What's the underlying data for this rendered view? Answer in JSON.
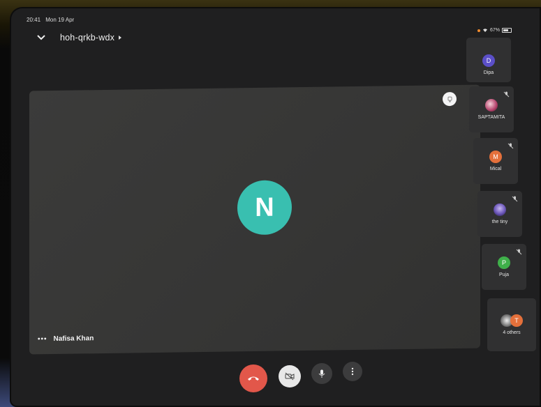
{
  "status": {
    "time": "20:41",
    "date": "Mon 19 Apr",
    "battery": "67%"
  },
  "meeting": {
    "code": "hoh-qrkb-wdx"
  },
  "main": {
    "initial": "N",
    "name": "Nafisa Khan",
    "avatar_color": "#39bfb0"
  },
  "participants": [
    {
      "name": "Dipa",
      "initial": "D",
      "color": "#5b4fc8",
      "muted": false
    },
    {
      "name": "SAPTAMITA",
      "initial": "",
      "color": "#b3406a",
      "muted": true
    },
    {
      "name": "Mical",
      "initial": "M",
      "color": "#e4703b",
      "muted": true
    },
    {
      "name": "the tiny",
      "initial": "",
      "color": "#6a55b8",
      "muted": true
    },
    {
      "name": "Puja",
      "initial": "P",
      "color": "#3fb04a",
      "muted": true
    },
    {
      "name": "4 others",
      "initial": "T",
      "color": "#e4703b",
      "muted": false
    }
  ],
  "colors": {
    "end_call": "#e2574a",
    "control_bg": "#3c3c3d",
    "camera_off_bg": "#e8e8e8"
  }
}
